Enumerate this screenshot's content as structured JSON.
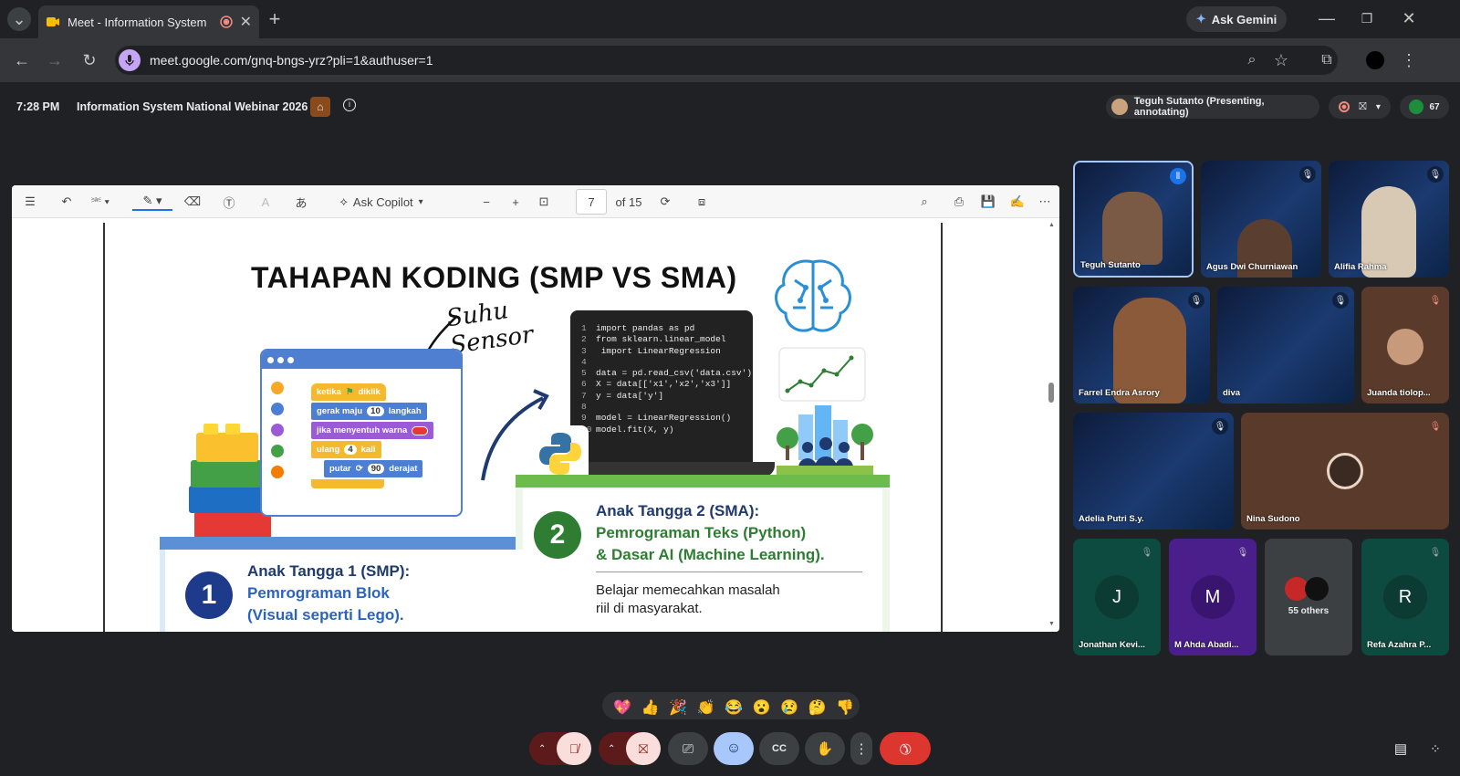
{
  "browser": {
    "tab_title": "Meet - Information System",
    "url": "meet.google.com/gnq-bngs-yrz?pli=1&authuser=1",
    "ask_gemini": "Ask Gemini"
  },
  "meet": {
    "time": "7:28 PM",
    "meeting_title": "Information System National Webinar 2026",
    "presenter_label": "Teguh Sutanto (Presenting, annotating)",
    "participant_count": "67"
  },
  "pdf": {
    "ask_copilot": "Ask Copilot",
    "page_number": "7",
    "page_total": "of 15"
  },
  "slide": {
    "title": "TAHAPAN KODING (SMP VS SMA)",
    "handwriting": "Suhu Sensor",
    "scratch_blocks": [
      "ketika",
      "diklik",
      "gerak maju",
      "10",
      "langkah",
      "jika menyentuh warna",
      "ulang",
      "4",
      "kali",
      "putar",
      "90",
      "derajat"
    ],
    "code_lines": [
      "import pandas as pd",
      "from sklearn.linear_model",
      " import LinearRegression",
      "",
      "data = pd.read_csv('data.csv')",
      "X = data[['x1','x2','x3']]",
      "y = data['y']",
      "",
      "model = LinearRegression()",
      "model.fit(X, y)"
    ],
    "code_numbers": [
      "1",
      "2",
      "3",
      "4",
      "5",
      "6",
      "7",
      "8",
      "9",
      "10"
    ],
    "step1_number": "1",
    "step1_title": "Anak Tangga 1 (SMP):",
    "step1_sub1": "Pemrograman Blok",
    "step1_sub2": "(Visual seperti Lego).",
    "step2_number": "2",
    "step2_title": "Anak Tangga 2 (SMA):",
    "step2_sub1": "Pemrograman Teks (Python)",
    "step2_sub2": "& Dasar AI (Machine Learning).",
    "step2_body1": "Belajar memecahkan masalah",
    "step2_body2": "riil di masyarakat."
  },
  "participants": [
    {
      "name": "Teguh Sutanto"
    },
    {
      "name": "Agus Dwi Churniawan"
    },
    {
      "name": "Alifia Rahma"
    },
    {
      "name": "Farrel Endra Asrory"
    },
    {
      "name": "diva"
    },
    {
      "name": "Juanda tiolop..."
    },
    {
      "name": "Adelia Putri S.y."
    },
    {
      "name": "Nina Sudono"
    },
    {
      "name": "Jonathan Kevi...",
      "initial": "J"
    },
    {
      "name": "M Ahda Abadi...",
      "initial": "M"
    },
    {
      "name": "55 others"
    },
    {
      "name": "Refa Azahra P...",
      "initial": "R"
    }
  ],
  "reactions": [
    "💖",
    "👍",
    "🎉",
    "👏",
    "😂",
    "😮",
    "😢",
    "🤔",
    "👎"
  ],
  "colors": {
    "accent_red": "#ea4335",
    "ctl_active": "#a8c7fa",
    "tile_teal": "#0d4a3f",
    "tile_purple": "#4a1f8c"
  }
}
